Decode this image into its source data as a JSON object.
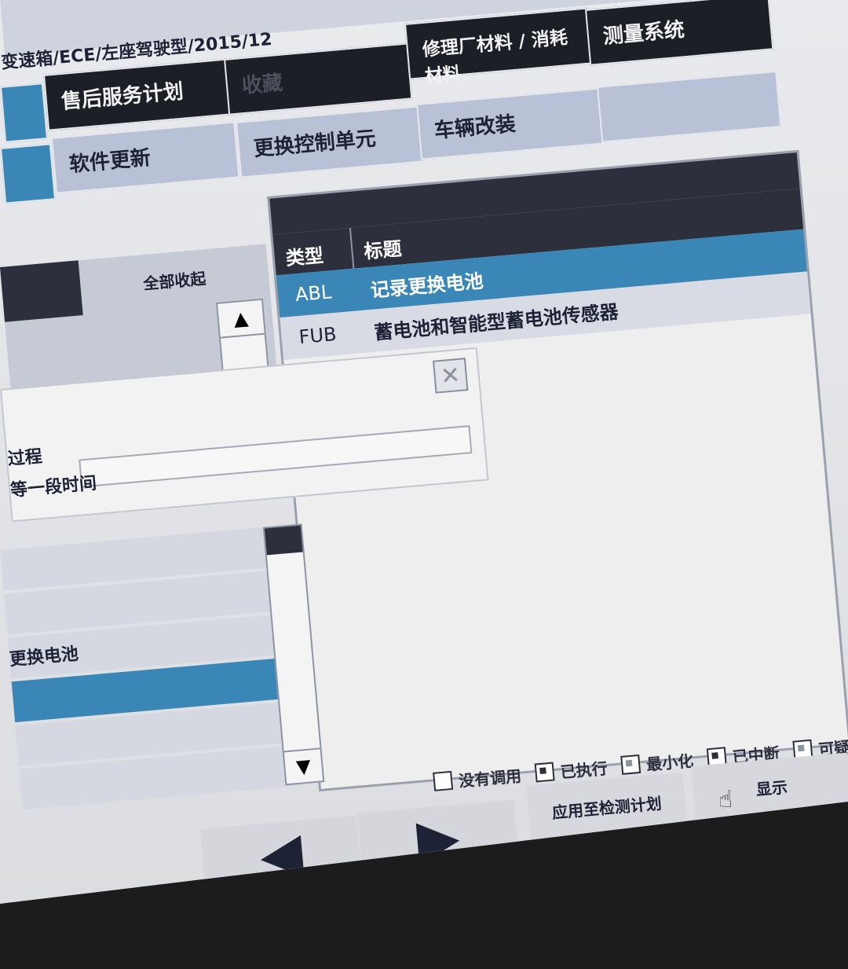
{
  "header": {
    "vehicle_title": "变速箱/ECE/左座驾驶型/2015/12"
  },
  "menu": {
    "row1": [
      "售后服务计划",
      "收藏",
      "修理厂材料 / 消耗材料",
      "测量系统"
    ],
    "row2": [
      "软件更新",
      "更换控制单元",
      "车辆改装"
    ]
  },
  "left_panel": {
    "collapse_all": "全部收起"
  },
  "table": {
    "columns": [
      "类型 ▲",
      "标题"
    ],
    "rows": [
      {
        "type": "ABL",
        "title": "记录更换电池"
      },
      {
        "type": "FUB",
        "title": "蓄电池和智能型蓄电池传感器"
      }
    ]
  },
  "dialog": {
    "close_icon": "✕",
    "line1": "过程",
    "line2": "等一段时间"
  },
  "lower_list": {
    "rows": [
      "",
      "",
      "更换电池",
      "",
      "",
      ""
    ],
    "selected_index": 3
  },
  "legend": [
    {
      "label": "没有调用",
      "style": "empty"
    },
    {
      "label": "已执行",
      "style": "fill"
    },
    {
      "label": "最小化",
      "style": "soft"
    },
    {
      "label": "已中断",
      "style": "fill"
    },
    {
      "label": "可疑",
      "style": "soft"
    }
  ],
  "buttons": {
    "apply_to_plan": "应用至检测计划",
    "show": "显示",
    "prev_glyph": "◀",
    "next_glyph": "▶"
  },
  "colors": {
    "selected_blue": "#3a86b7",
    "dark_bar": "#2d2f3c",
    "tile": "#b8c1d6"
  }
}
